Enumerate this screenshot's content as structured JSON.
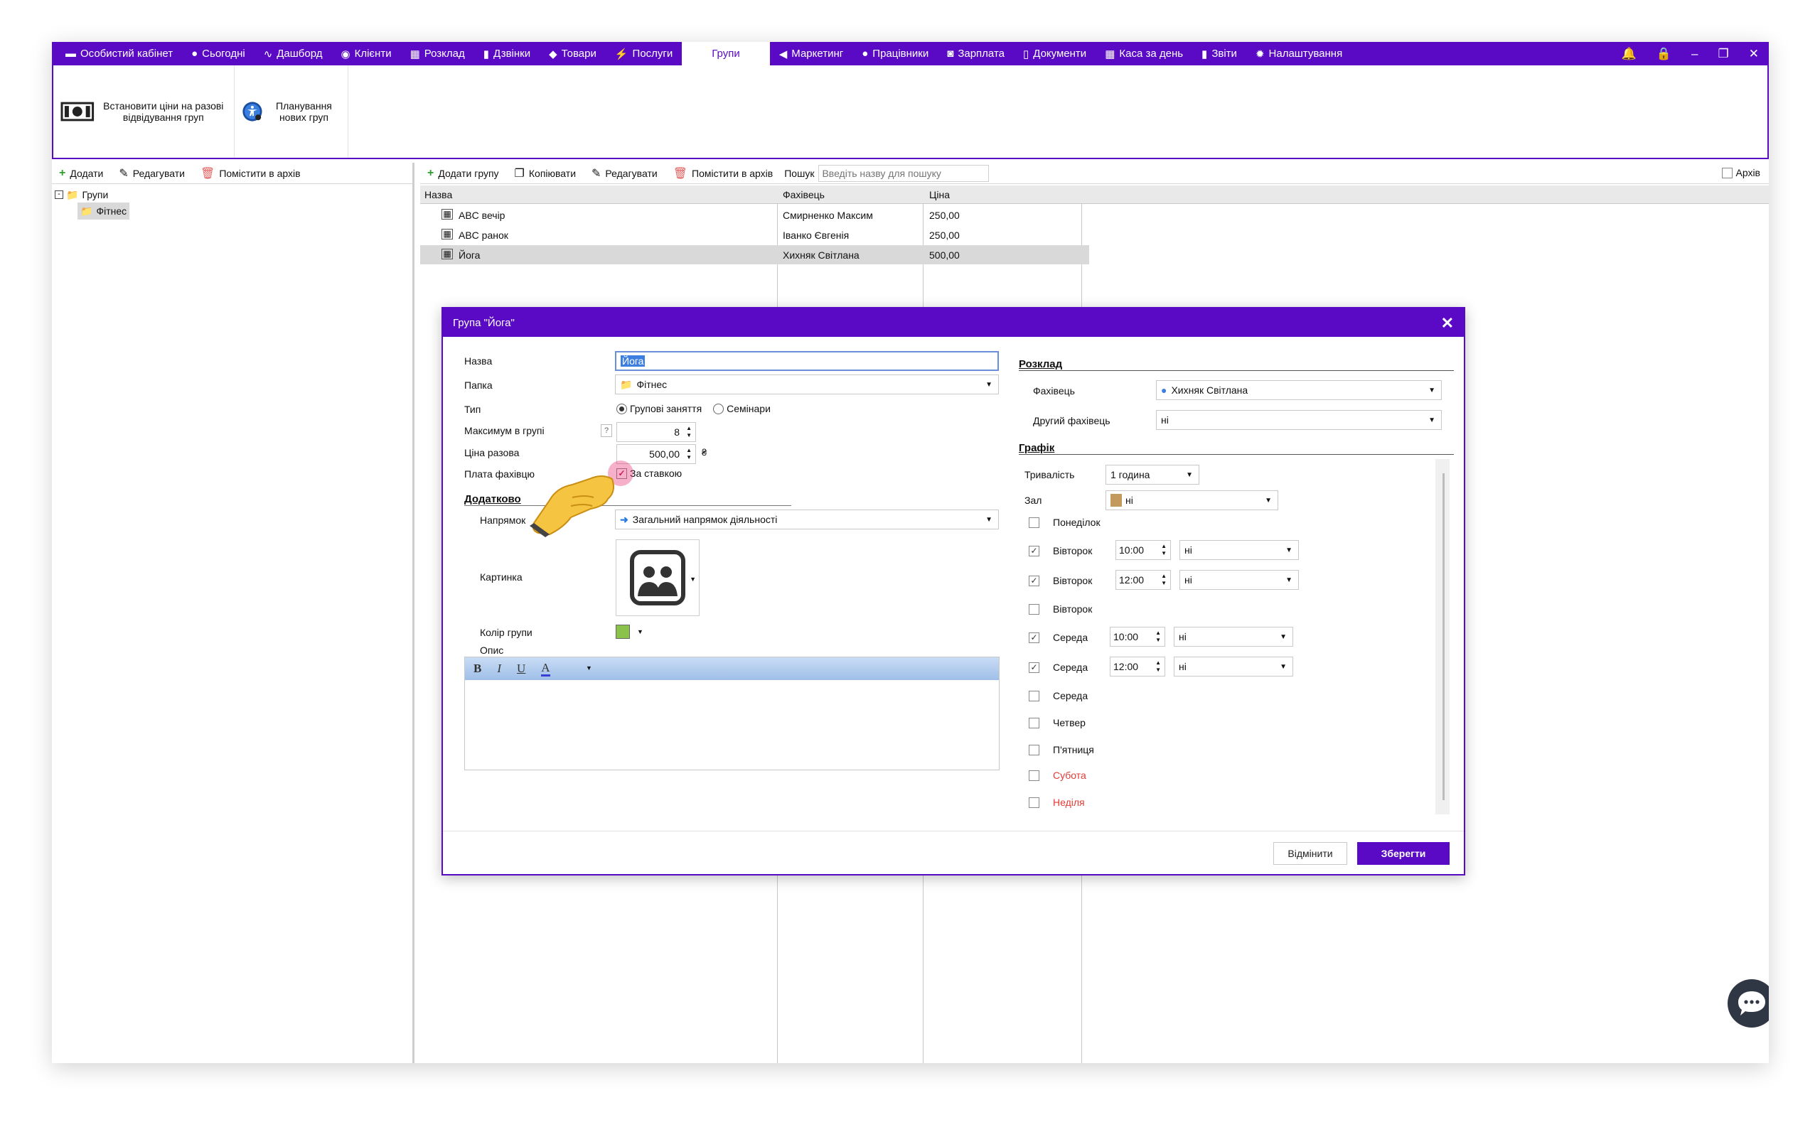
{
  "menu": {
    "items": [
      {
        "label": "Особистий кабінет",
        "icon": "wallet-icon"
      },
      {
        "label": "Сьогодні",
        "icon": "clock-icon"
      },
      {
        "label": "Дашборд",
        "icon": "pulse-icon"
      },
      {
        "label": "Клієнти",
        "icon": "user-circle-icon"
      },
      {
        "label": "Розклад",
        "icon": "calendar-icon"
      },
      {
        "label": "Дзвінки",
        "icon": "phone-icon"
      },
      {
        "label": "Товари",
        "icon": "box-icon"
      },
      {
        "label": "Послуги",
        "icon": "bolt-icon"
      },
      {
        "label": "Групи",
        "icon": "",
        "active": true
      },
      {
        "label": "Маркетинг",
        "icon": "megaphone-icon"
      },
      {
        "label": "Працівники",
        "icon": "person-icon"
      },
      {
        "label": "Зарплата",
        "icon": "money-icon"
      },
      {
        "label": "Документи",
        "icon": "document-icon"
      },
      {
        "label": "Каса за день",
        "icon": "calculator-icon"
      },
      {
        "label": "Звіти",
        "icon": "bar-chart-icon"
      },
      {
        "label": "Налаштування",
        "icon": "gear-icon"
      }
    ]
  },
  "ribbon": {
    "set_prices": "Встановити ціни на разові відвідування груп",
    "planning": "Планування нових груп"
  },
  "left_toolbar": {
    "add": "Додати",
    "edit": "Редагувати",
    "archive": "Помістити в архів"
  },
  "tree": {
    "root": "Групи",
    "child": "Фітнес"
  },
  "right_toolbar": {
    "add_group": "Додати групу",
    "copy": "Копіювати",
    "edit": "Редагувати",
    "archive": "Помістити в архів",
    "search_label": "Пошук",
    "search_placeholder": "Введіть назву для пошуку",
    "archive_check": "Архів"
  },
  "grid": {
    "columns": [
      "Назва",
      "Фахівець",
      "Ціна"
    ],
    "rows": [
      {
        "name": "ABC вечір",
        "specialist": "Смирненко Максим",
        "price": "250,00"
      },
      {
        "name": "ABC ранок",
        "specialist": "Іванко Євгенія",
        "price": "250,00"
      },
      {
        "name": "Йога",
        "specialist": "Хихняк Світлана",
        "price": "500,00"
      }
    ]
  },
  "dialog": {
    "title": "Група \"Йога\"",
    "name_label": "Назва",
    "name_value": "Йога",
    "folder_label": "Папка",
    "folder_value": "Фітнес",
    "type_label": "Тип",
    "type_group": "Групові заняття",
    "type_seminar": "Семінари",
    "max_label": "Максимум в групі",
    "max_value": "8",
    "max_help": "?",
    "price_label": "Ціна разова",
    "price_value": "500,00",
    "currency": "₴",
    "pay_label": "Плата фахівцю",
    "pay_rate": "За ставкою",
    "extra_section": "Додатково",
    "direction_label": "Напрямок",
    "direction_value": "Загальний напрямок діяльності",
    "picture_label": "Картинка",
    "color_label": "Колір групи",
    "color_value": "#8bc34a",
    "desc_label": "Опис",
    "fmt_bold": "B",
    "fmt_italic": "I",
    "fmt_underline": "U",
    "fmt_color": "A",
    "schedule_section": "Розклад",
    "spec_label": "Фахівець",
    "spec_value": "Хихняк Світлана",
    "spec2_label": "Другий фахівець",
    "spec2_value": "ні",
    "graph_section": "Графік",
    "duration_label": "Тривалість",
    "duration_value": "1 година",
    "hall_label": "Зал",
    "hall_value": "ні",
    "days": [
      {
        "label": "Понеділок",
        "checked": false,
        "time": "",
        "room": "",
        "weekend": false
      },
      {
        "label": "Вівторок",
        "checked": true,
        "time": "10:00",
        "room": "ні",
        "weekend": false
      },
      {
        "label": "Вівторок",
        "checked": true,
        "time": "12:00",
        "room": "ні",
        "weekend": false
      },
      {
        "label": "Вівторок",
        "checked": false,
        "time": "",
        "room": "",
        "weekend": false
      },
      {
        "label": "Середа",
        "checked": true,
        "time": "10:00",
        "room": "ні",
        "weekend": false
      },
      {
        "label": "Середа",
        "checked": true,
        "time": "12:00",
        "room": "ні",
        "weekend": false
      },
      {
        "label": "Середа",
        "checked": false,
        "time": "",
        "room": "",
        "weekend": false
      },
      {
        "label": "Четвер",
        "checked": false,
        "time": "",
        "room": "",
        "weekend": false
      },
      {
        "label": "П'ятниця",
        "checked": false,
        "time": "",
        "room": "",
        "weekend": false
      },
      {
        "label": "Субота",
        "checked": false,
        "time": "",
        "room": "",
        "weekend": true
      },
      {
        "label": "Неділя",
        "checked": false,
        "time": "",
        "room": "",
        "weekend": true
      }
    ],
    "cancel": "Відмінити",
    "save": "Зберегти"
  },
  "colors": {
    "brand": "#5a0ac4",
    "weekend": "#e53935",
    "selection": "#d9d9d9"
  }
}
